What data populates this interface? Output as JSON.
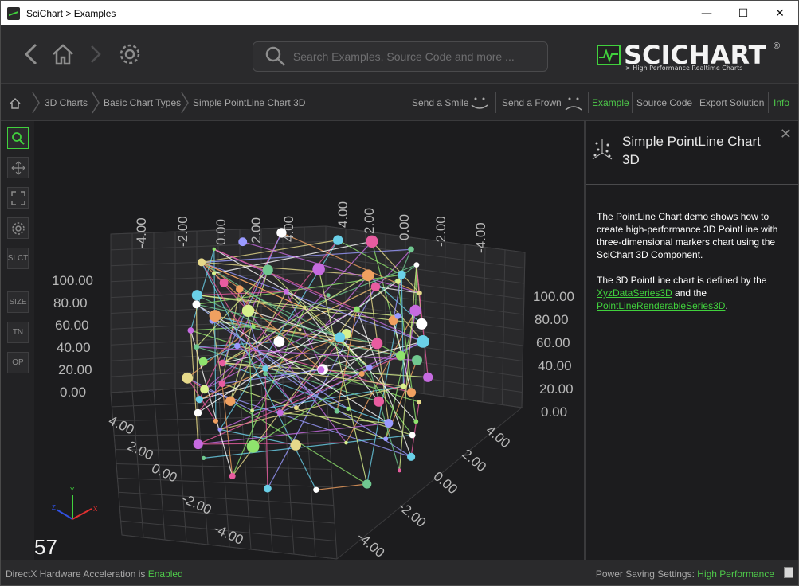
{
  "window": {
    "title": "SciChart > Examples",
    "minimize": "—",
    "maximize": "☐",
    "close": "✕"
  },
  "toolbar": {
    "search_placeholder": "Search Examples, Source Code and more ...",
    "logo_text": "SCICHART",
    "logo_reg": "®",
    "logo_tagline": "> High Performance Realtime Charts"
  },
  "breadcrumb": {
    "items": [
      "3D Charts",
      "Basic Chart Types",
      "Simple PointLine Chart 3D"
    ],
    "send_smile": "Send a Smile",
    "send_frown": "Send a Frown",
    "tab_example": "Example",
    "tab_source": "Source Code",
    "tab_export": "Export Solution",
    "tab_info": "Info"
  },
  "tools": [
    "SLCT",
    "SIZE",
    "TN",
    "OP"
  ],
  "chart": {
    "fps": "57",
    "top_labels_left": [
      "-4.00",
      "-2.00",
      "0.00",
      "2.00",
      "4.00"
    ],
    "top_labels_right": [
      "4.00",
      "2.00",
      "0.00",
      "-2.00",
      "-4.00"
    ],
    "y_left": [
      "100.00",
      "80.00",
      "60.00",
      "40.00",
      "20.00",
      "0.00"
    ],
    "y_right": [
      "100.00",
      "80.00",
      "60.00",
      "40.00",
      "20.00",
      "0.00"
    ],
    "bottom_left": [
      "4.00",
      "2.00",
      "0.00",
      "-2.00",
      "-4.00"
    ],
    "bottom_right": [
      "4.00",
      "2.00",
      "0.00",
      "-2.00",
      "-4.00"
    ],
    "axis_x": "X",
    "axis_y": "Y",
    "axis_z": "Z"
  },
  "info": {
    "title": "Simple PointLine Chart 3D",
    "close": "✕",
    "para1": "The PointLine Chart demo shows how to create high-performance 3D PointLine with three-dimensional markers chart using the SciChart 3D Component.",
    "para2_pre": "The 3D PointLine chart is defined by the ",
    "link1": "XyzDataSeries3D",
    "para2_mid": " and the ",
    "link2": "PointLineRenderableSeries3D",
    "para2_post": "."
  },
  "status": {
    "left_label": "DirectX Hardware Acceleration is ",
    "left_value": "Enabled",
    "right_label": "Power Saving Settings: ",
    "right_value": "High Performance"
  },
  "colors": {
    "accent": "#41d13d",
    "background": "#1c1c1e",
    "toolbar": "#2a2a2c"
  }
}
